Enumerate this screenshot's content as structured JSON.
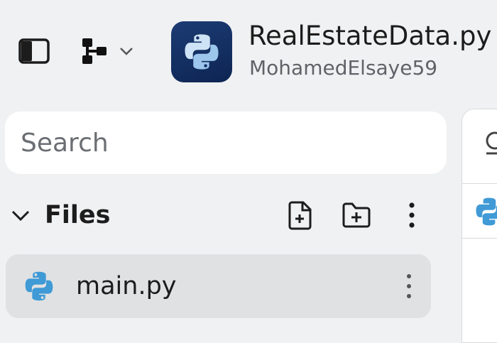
{
  "header": {
    "repl_title": "RealEstateData.py",
    "repl_owner": "MohamedElsaye59",
    "logo_icon": "python-icon",
    "sidebar_toggle_icon": "sidebar-toggle-icon",
    "vcs_icon": "git-branch-icon",
    "vcs_dropdown_icon": "chevron-down-icon"
  },
  "search": {
    "placeholder": "Search"
  },
  "files": {
    "label": "Files",
    "collapse_icon": "chevron-down-icon",
    "actions": [
      "new-file-icon",
      "new-folder-icon",
      "more-vertical-icon"
    ],
    "items": [
      {
        "name": "main.py",
        "icon": "python-icon"
      }
    ]
  },
  "colors": {
    "background": "#f0f1f2",
    "logo_bg": "#13316a",
    "python_blue": "#3f9ad6",
    "selected_row": "#e0e1e3"
  }
}
